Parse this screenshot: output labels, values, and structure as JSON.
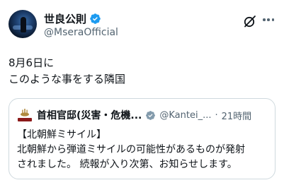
{
  "author": {
    "display_name": "世良公則",
    "handle": "@MseraOfficial"
  },
  "post": {
    "line1": "8月6日に",
    "line2": "このような事をする隣国"
  },
  "quote": {
    "display_name": "首相官邸(災害・危機...",
    "handle": "@Kantei_...",
    "separator": "·",
    "time": "21時間",
    "body_line1": "【北朝鮮ミサイル】",
    "body_line2": "北朝鮮から弾道ミサイルの可能性があるものが発射",
    "body_line3": "されました。 続報が入り次第、お知らせします。"
  },
  "colors": {
    "verified": "#1d9bf0",
    "secondary_text": "#536471",
    "border": "#cfd9de"
  },
  "icons": [
    "verified-badge-icon",
    "grok-icon",
    "more-options-icon"
  ]
}
